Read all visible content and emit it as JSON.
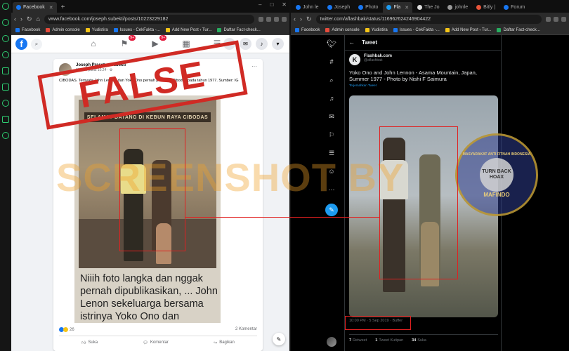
{
  "left_browser": {
    "tabs": [
      {
        "label": "Facebook",
        "active": true
      }
    ],
    "new_tab_symbol": "+",
    "window_controls": [
      "–",
      "□",
      "✕"
    ],
    "address": "www.facebook.com/joseph.subekti/posts/10223229182",
    "bookmarks": [
      "Facebook",
      "Admin console",
      "Yudistira",
      "Issues - CekFakta -...",
      "Add New Post ‹ Tur...",
      "Daftar Fact-check..."
    ]
  },
  "right_browser": {
    "tabs": [
      {
        "label": "John le",
        "active": false
      },
      {
        "label": "Joseph",
        "active": false
      },
      {
        "label": "Photo",
        "active": false
      },
      {
        "label": "Fla",
        "active": true
      },
      {
        "label": "The Jo",
        "active": false
      },
      {
        "label": "johnle",
        "active": false
      },
      {
        "label": "Bitly |",
        "active": false
      },
      {
        "label": "Forum",
        "active": false
      }
    ],
    "address": "twitter.com/aflashbak/status/116962624246904422",
    "bookmarks": [
      "Facebook",
      "Admin console",
      "Yudistira",
      "Issues - CekFakta -...",
      "Add New Post ‹ Tur...",
      "Daftar Fact-check..."
    ]
  },
  "facebook": {
    "logo": "f",
    "badges": {
      "flag": "9+",
      "watch": "9+"
    },
    "post": {
      "author": "Joseph Prasetya Subekti",
      "date": "23 Juni pukul 10.24 · ⚙",
      "text": "CIBODAS. Ternyata John Lennon dan Yoko Ono pernah piknik ke Cibodas pada tahun 1977.  Sumber: IG",
      "photo_sign": "SELAMAT DATANG DI KEBUN RAYA CIBODAS",
      "meme_text": "Niiih foto langka dan nggak pernah dipublikasikan, ... John Lenon sekeluarga bersama istrinya Yoko Ono dan",
      "reactions_count": "26",
      "comments_count": "2 Komentar",
      "actions": [
        "Suka",
        "Komentar",
        "Bagikan"
      ]
    }
  },
  "twitter": {
    "header": "Tweet",
    "account_name": "Flashbak.com",
    "handle": "@aflashbak",
    "tweet_text": "Yoko Ono and John Lennon - Asama Mountain, Japan, Summer 1977 - Photo by Nishi F Saimura",
    "translate": "Terjemahkan Tweet",
    "meta": "10:00 PM · 5 Sep 2019 · Buffer",
    "stats": {
      "retweets": "7",
      "retweets_label": "Retweet",
      "quotes": "1",
      "quotes_label": "Tweet Kutipan",
      "likes": "34",
      "likes_label": "Suka"
    }
  },
  "overlays": {
    "stamp": "FALSE",
    "watermark": "SCREENSHOT BY",
    "badge_top": "MASYARAKAT ANTI FITNAH INDONESIA",
    "badge_center": "TURN BACK HOAX",
    "badge_bottom": "MAFINDO"
  },
  "colors": {
    "facebook_blue": "#1877f2",
    "twitter_blue": "#1d9bf0",
    "stamp_red": "#d02a24",
    "highlight_red": "#e02020"
  }
}
